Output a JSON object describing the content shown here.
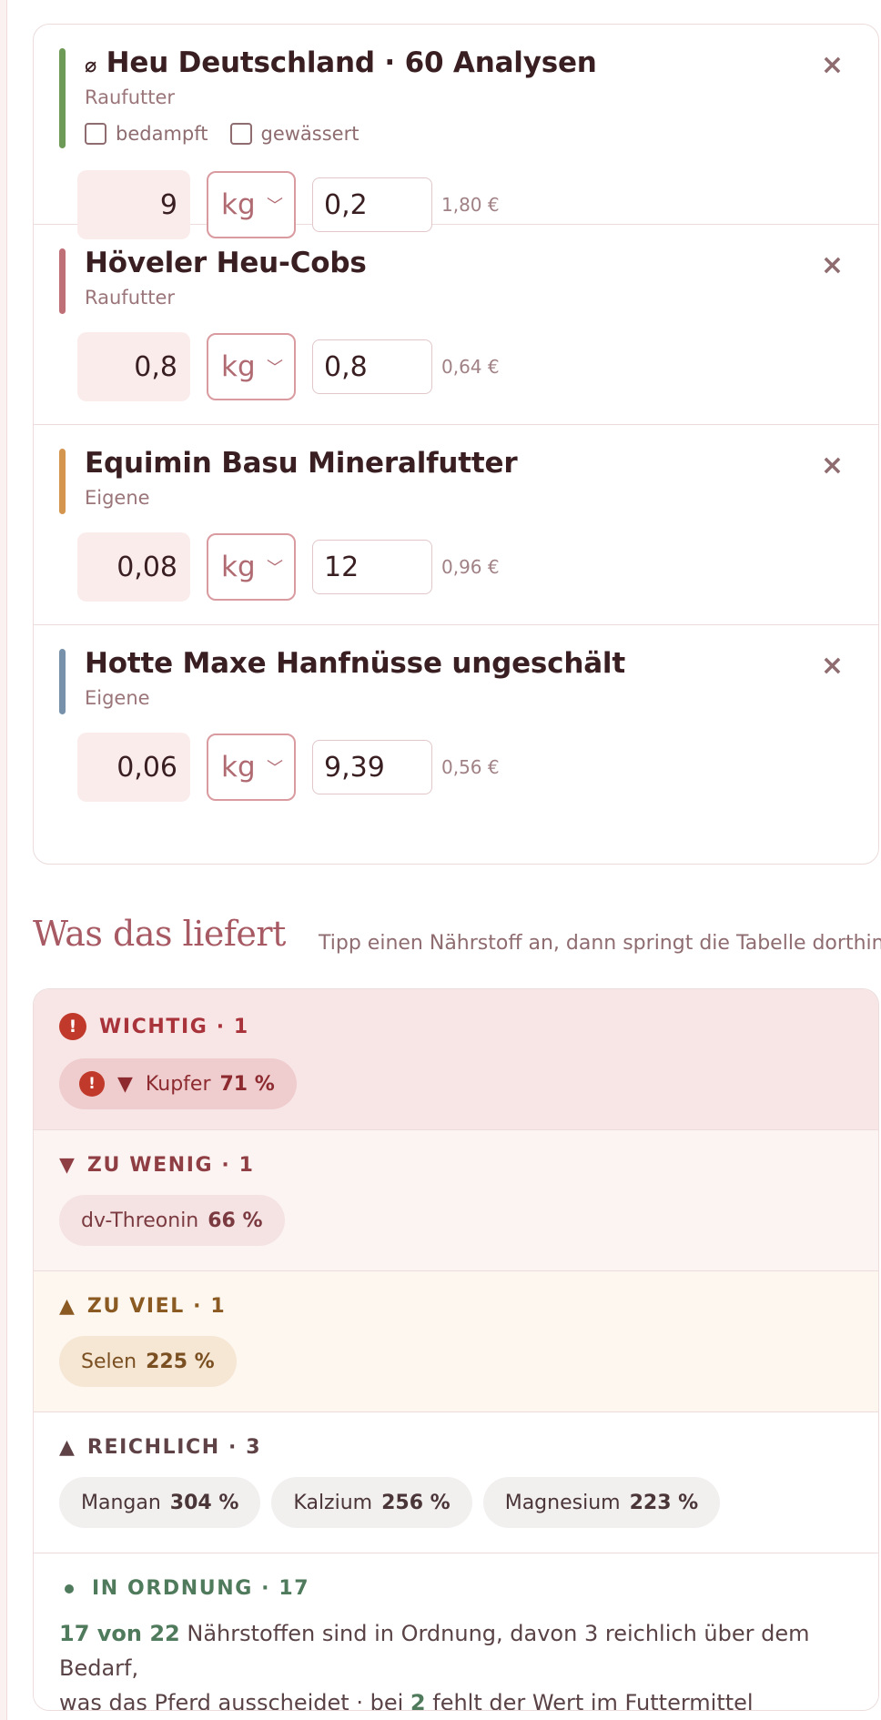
{
  "feeds": [
    {
      "icon_prefix": "⌀",
      "name": "Heu Deutschland · 60 Analysen",
      "category": "Raufutter",
      "color": "#6e9a58",
      "checkboxes": [
        {
          "label": "bedampft",
          "checked": false
        },
        {
          "label": "gewässert",
          "checked": false
        }
      ],
      "quantity": "9",
      "unit": "kg",
      "price": "0,2",
      "cost": "1,80 €"
    },
    {
      "icon_prefix": "",
      "name": "Höveler Heu-Cobs",
      "category": "Raufutter",
      "color": "#bf6f76",
      "quantity": "0,8",
      "unit": "kg",
      "price": "0,8",
      "cost": "0,64 €"
    },
    {
      "icon_prefix": "",
      "name": "Equimin Basu Mineralfutter",
      "category": "Eigene",
      "color": "#d4964f",
      "quantity": "0,08",
      "unit": "kg",
      "price": "12",
      "cost": "0,96 €"
    },
    {
      "icon_prefix": "",
      "name": "Hotte Maxe Hanfnüsse ungeschält",
      "category": "Eigene",
      "color": "#7891ab",
      "quantity": "0,06",
      "unit": "kg",
      "price": "9,39",
      "cost": "0,56 €"
    }
  ],
  "close_symbol": "×",
  "summary": {
    "title": "Was das liefert",
    "hint": "Tipp einen Nährstoff an, dann springt die Tabelle dorthin",
    "groups": {
      "wichtig": {
        "label": "WICHTIG · 1",
        "color": "#a8333a",
        "chips": [
          {
            "name": "Kupfer",
            "value": "71 %"
          }
        ]
      },
      "wenig": {
        "label": "ZU WENIG · 1",
        "color": "#8f3e44",
        "chips": [
          {
            "name": "dv-Threonin",
            "value": "66 %"
          }
        ]
      },
      "viel": {
        "label": "ZU VIEL · 1",
        "color": "#8a5a22",
        "chips": [
          {
            "name": "Selen",
            "value": "225 %"
          }
        ]
      },
      "reich": {
        "label": "REICHLICH · 3",
        "color": "#5e4246",
        "chips": [
          {
            "name": "Mangan",
            "value": "304 %"
          },
          {
            "name": "Kalzium",
            "value": "256 %"
          },
          {
            "name": "Magnesium",
            "value": "223 %"
          }
        ]
      },
      "ok": {
        "label": "IN ORDNUNG · 17",
        "color": "#4f7a5b",
        "text": {
          "count": "17 von 22",
          "line1": " Nährstoffen sind in Ordnung, davon 3 reichlich über dem Bedarf,",
          "line2": "was das Pferd ausscheidet · bei ",
          "missing": "2",
          "line3": " fehlt der Wert im Futtermittel"
        }
      }
    }
  }
}
